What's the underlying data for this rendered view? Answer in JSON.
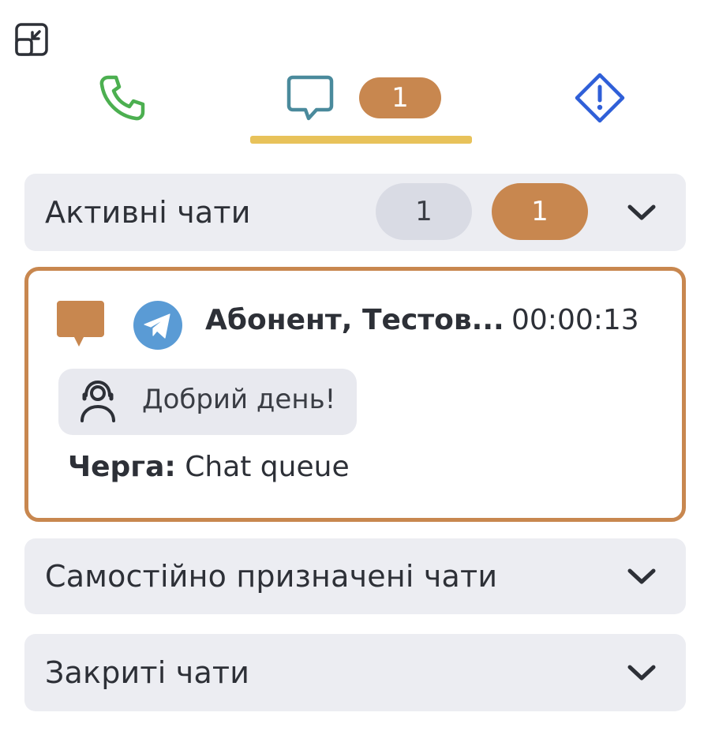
{
  "colors": {
    "accent_orange": "#c8874f",
    "underline_yellow": "#e8c25a",
    "phone_green": "#4caf50",
    "chat_teal": "#4a8a9c",
    "alert_blue": "#2f5fd8",
    "telegram_blue": "#5a9bd5",
    "section_bg": "#ecedf2"
  },
  "icons": {
    "collapse": "collapse-icon",
    "phone": "phone-icon",
    "chat": "chat-bubble-icon",
    "alert": "alert-diamond-icon",
    "channel": "telegram-icon",
    "agent": "agent-headset-icon",
    "chevron": "chevron-down-icon"
  },
  "tabs": {
    "chat_badge": "1",
    "active": "chat"
  },
  "sections": {
    "active": {
      "title": "Активні чати",
      "count_gray": "1",
      "count_orange": "1"
    },
    "self_assigned": {
      "title": "Самостійно призначені чати"
    },
    "closed": {
      "title": "Закриті чати"
    }
  },
  "chat_card": {
    "contact": "Абонент, Тестов...",
    "timer": "00:00:13",
    "message": "Добрий день!",
    "queue_label": "Черга:",
    "queue_value": "Chat queue"
  }
}
